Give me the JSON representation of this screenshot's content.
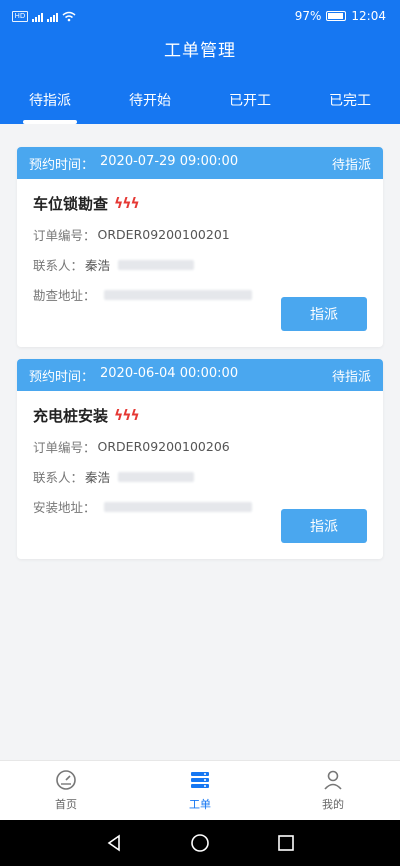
{
  "status_bar": {
    "sim_label": "HD",
    "battery_percent": "97%",
    "time": "12:04"
  },
  "header": {
    "title": "工单管理"
  },
  "tabs": [
    {
      "label": "待指派",
      "active": true
    },
    {
      "label": "待开始",
      "active": false
    },
    {
      "label": "已开工",
      "active": false
    },
    {
      "label": "已完工",
      "active": false
    }
  ],
  "orders": [
    {
      "time_label": "预约时间：",
      "time_value": "2020-07-29 09:00:00",
      "status": "待指派",
      "service_name": "车位锁勘查",
      "urgency": "ϟϟϟ",
      "order_no_label": "订单编号：",
      "order_no": "ORDER09200100201",
      "contact_label": "联系人：",
      "contact_name": "秦浩",
      "address_label": "勘查地址：",
      "action_label": "指派"
    },
    {
      "time_label": "预约时间：",
      "time_value": "2020-06-04 00:00:00",
      "status": "待指派",
      "service_name": "充电桩安装",
      "urgency": "ϟϟϟ",
      "order_no_label": "订单编号：",
      "order_no": "ORDER09200100206",
      "contact_label": "联系人：",
      "contact_name": "秦浩",
      "address_label": "安装地址：",
      "action_label": "指派"
    }
  ],
  "bottom_nav": [
    {
      "label": "首页",
      "icon": "dashboard-icon",
      "active": false
    },
    {
      "label": "工单",
      "icon": "list-icon",
      "active": true
    },
    {
      "label": "我的",
      "icon": "person-icon",
      "active": false
    }
  ],
  "colors": {
    "primary": "#1677f2",
    "card_header": "#4aa7ef",
    "urgency": "#e53935"
  }
}
